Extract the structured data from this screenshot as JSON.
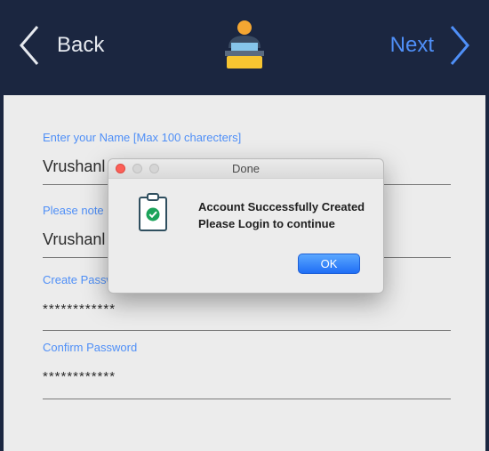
{
  "header": {
    "back_label": "Back",
    "next_label": "Next",
    "logo_icon": "user-at-laptop-icon",
    "accent_color": "#4f8ff7"
  },
  "form": {
    "fields": [
      {
        "label": "Enter your Name [Max 100 charecters]",
        "value": "Vrushanl"
      },
      {
        "label": "Please note",
        "value": "Vrushanl"
      },
      {
        "label": "Create Passw",
        "value": "************"
      },
      {
        "label": "Confirm Password",
        "value": "************"
      }
    ]
  },
  "dialog": {
    "title": "Done",
    "message_line1": "Account Successfully Created",
    "message_line2": "Please Login to continue",
    "ok_label": "OK",
    "icon": "clipboard-check-icon"
  }
}
